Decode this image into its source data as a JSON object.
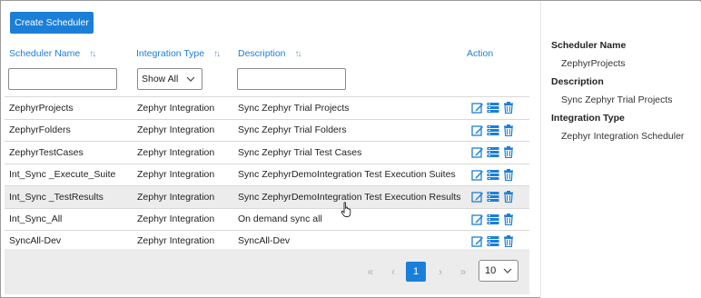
{
  "toolbar": {
    "create_label": "Create Scheduler"
  },
  "columns": {
    "name": "Scheduler Name",
    "type": "Integration Type",
    "description": "Description",
    "action": "Action",
    "sort_glyph": "↑↓"
  },
  "filters": {
    "name_value": "",
    "type_value": "Show All",
    "description_value": ""
  },
  "rows": [
    {
      "name": "ZephyrProjects",
      "type": "Zephyr Integration",
      "description": "Sync Zephyr Trial Projects"
    },
    {
      "name": "ZephyrFolders",
      "type": "Zephyr Integration",
      "description": "Sync Zephyr Trial Folders"
    },
    {
      "name": "ZephyrTestCases",
      "type": "Zephyr Integration",
      "description": "Sync Zephyr Trial Test Cases"
    },
    {
      "name": "Int_Sync _Execute_Suite",
      "type": "Zephyr Integration",
      "description": "Sync ZephyrDemoIntegration Test Execution Suites"
    },
    {
      "name": "Int_Sync _TestResults",
      "type": "Zephyr Integration",
      "description": "Sync ZephyrDemoIntegration Test Execution Results"
    },
    {
      "name": "Int_Sync_All",
      "type": "Zephyr Integration",
      "description": "On demand sync all"
    },
    {
      "name": "SyncAll-Dev",
      "type": "Zephyr Integration",
      "description": "SyncAll-Dev"
    }
  ],
  "highlighted_row": 4,
  "pagination": {
    "first": "«",
    "prev": "‹",
    "current": "1",
    "next": "›",
    "last": "»",
    "page_size": "10"
  },
  "details": {
    "name_label": "Scheduler Name",
    "name_value": "ZephyrProjects",
    "description_label": "Description",
    "description_value": "Sync Zephyr Trial Projects",
    "type_label": "Integration Type",
    "type_value": "Zephyr Integration Scheduler"
  },
  "colors": {
    "accent": "#1b7fd8",
    "highlight_row": "#ececec",
    "action_icon": "#1b7fd8"
  },
  "icons": {
    "action_edit": "edit-icon",
    "action_details": "details-icon",
    "action_delete": "trash-icon"
  }
}
